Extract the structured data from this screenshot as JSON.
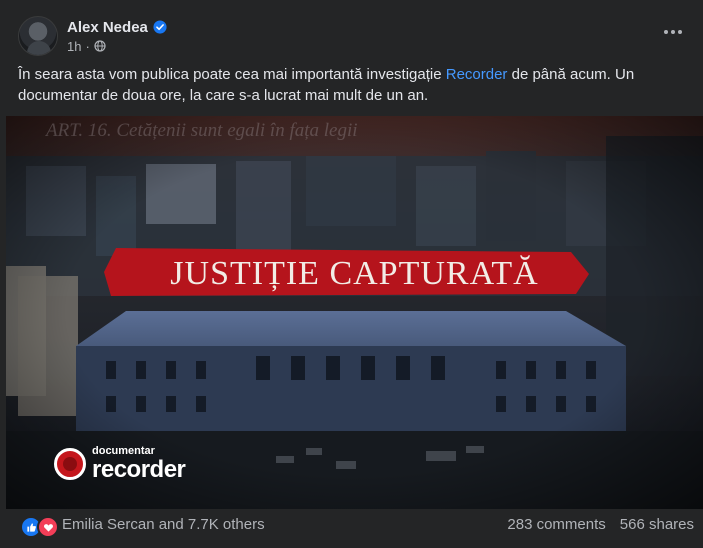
{
  "post": {
    "author": "Alex Nedea",
    "time": "1h",
    "text_before": "În seara asta vom publica poate cea mai importantă investigație ",
    "text_link": "Recorder",
    "text_after": " de până acum. Un documentar de doua ore, la care s-a lucrat mai mult de un an."
  },
  "media": {
    "title": "JUSTIȚIE CAPTURATĂ",
    "faint_caption": "ART. 16. Cetățenii sunt egali în fața legii",
    "brand_small": "documentar",
    "brand_big": "recorder"
  },
  "footer": {
    "reactions_text": "Emilia Sercan and 7.7K others",
    "comments": "283 comments",
    "shares": "566 shares"
  },
  "icons": {
    "verified": "verified-badge-icon",
    "privacy": "globe-icon",
    "more": "more-options-icon",
    "like": "like-reaction-icon",
    "love": "love-reaction-icon"
  },
  "colors": {
    "background": "#242526",
    "link": "#4599ff",
    "banner": "#b5141c",
    "like": "#1877f2",
    "love": "#f33e58"
  }
}
